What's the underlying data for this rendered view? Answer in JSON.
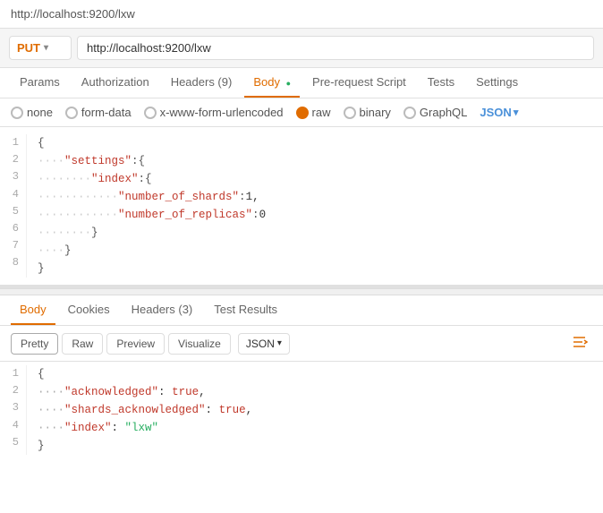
{
  "titleBar": {
    "url": "http://localhost:9200/lxw"
  },
  "requestBar": {
    "method": "PUT",
    "url": "http://localhost:9200/lxw"
  },
  "tabs": [
    {
      "label": "Params",
      "active": false
    },
    {
      "label": "Authorization",
      "active": false
    },
    {
      "label": "Headers (9)",
      "active": false
    },
    {
      "label": "Body",
      "active": true,
      "dot": true
    },
    {
      "label": "Pre-request Script",
      "active": false
    },
    {
      "label": "Tests",
      "active": false
    },
    {
      "label": "Settings",
      "active": false
    }
  ],
  "bodyOptions": [
    {
      "label": "none",
      "selected": false
    },
    {
      "label": "form-data",
      "selected": false
    },
    {
      "label": "x-www-form-urlencoded",
      "selected": false
    },
    {
      "label": "raw",
      "selected": true
    },
    {
      "label": "binary",
      "selected": false
    },
    {
      "label": "GraphQL",
      "selected": false
    }
  ],
  "jsonLabel": "JSON",
  "codeLines": [
    {
      "num": 1,
      "content": "{"
    },
    {
      "num": 2,
      "content": "    \"settings\":{"
    },
    {
      "num": 3,
      "content": "        \"index\":{"
    },
    {
      "num": 4,
      "content": "            \"number_of_shards\":1,"
    },
    {
      "num": 5,
      "content": "            \"number_of_replicas\":0"
    },
    {
      "num": 6,
      "content": "        }"
    },
    {
      "num": 7,
      "content": "    }"
    },
    {
      "num": 8,
      "content": "}"
    }
  ],
  "responseTabs": [
    {
      "label": "Body",
      "active": true
    },
    {
      "label": "Cookies",
      "active": false
    },
    {
      "label": "Headers (3)",
      "active": false
    },
    {
      "label": "Test Results",
      "active": false
    }
  ],
  "formatButtons": [
    {
      "label": "Pretty",
      "active": true
    },
    {
      "label": "Raw",
      "active": false
    },
    {
      "label": "Preview",
      "active": false
    },
    {
      "label": "Visualize",
      "active": false
    }
  ],
  "responseJsonLabel": "JSON",
  "responseLines": [
    {
      "num": 1,
      "content": "{"
    },
    {
      "num": 2,
      "key": "acknowledged",
      "value": "true",
      "valueType": "bool"
    },
    {
      "num": 3,
      "key": "shards_acknowledged",
      "value": "true",
      "valueType": "bool"
    },
    {
      "num": 4,
      "key": "index",
      "value": "\"lxw\"",
      "valueType": "string"
    },
    {
      "num": 5,
      "content": "}"
    }
  ]
}
